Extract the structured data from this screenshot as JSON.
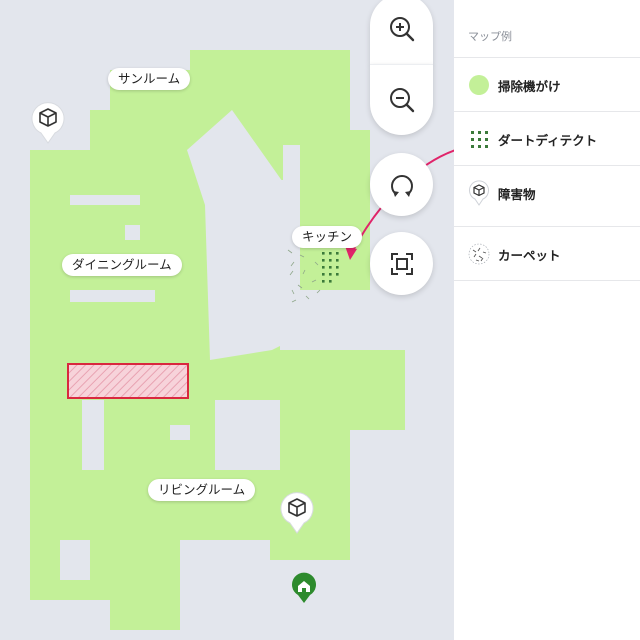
{
  "rooms": {
    "sunroom": "サンルーム",
    "dining": "ダイニングルーム",
    "kitchen": "キッチン",
    "living": "リビングルーム"
  },
  "icons": {
    "zoom_in": "zoom-in-icon",
    "zoom_out": "zoom-out-icon",
    "rotate": "rotate-icon",
    "fit": "fit-screen-icon",
    "obstacle": "cube-icon",
    "dock": "home-icon"
  },
  "legend": {
    "heading": "マップ例",
    "items": [
      {
        "label": "掃除機がけ",
        "icon": "green-circle-icon"
      },
      {
        "label": "ダートディテクト",
        "icon": "dots-grid-icon"
      },
      {
        "label": "障害物",
        "icon": "cube-pin-icon"
      },
      {
        "label": "カーペット",
        "icon": "carpet-icon"
      }
    ]
  },
  "colors": {
    "cleaned": "#c3f098",
    "background": "#e3e6ed",
    "dirt": "#3b7a3a",
    "highlight": "#d9283e",
    "arrow": "#e0246a",
    "dock": "#2d8a2d"
  }
}
